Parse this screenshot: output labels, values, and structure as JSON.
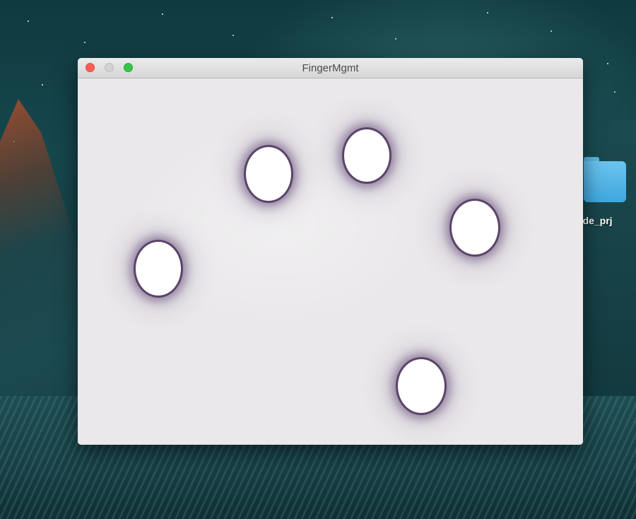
{
  "window": {
    "title": "FingerMgmt"
  },
  "desktop": {
    "folder_label": "ode_prj"
  },
  "touches_count_visible": 5,
  "colors": {
    "touch_fill": "#ffffff",
    "touch_glow": "#5a4569",
    "canvas_bg": "#eae8ea"
  }
}
